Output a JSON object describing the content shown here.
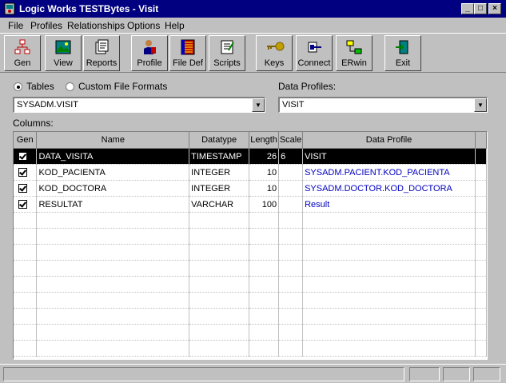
{
  "window": {
    "title": "Logic Works TESTBytes - Visit"
  },
  "menu": [
    {
      "label": "File"
    },
    {
      "label": "Profiles"
    },
    {
      "label": "Relationships"
    },
    {
      "label": "Options"
    },
    {
      "label": "Help"
    }
  ],
  "toolbar": {
    "gen": "Gen",
    "view": "View",
    "reports": "Reports",
    "profile": "Profile",
    "filedef": "File Def",
    "scripts": "Scripts",
    "keys": "Keys",
    "connect": "Connect",
    "erwin": "ERwin",
    "exit": "Exit"
  },
  "form": {
    "tables_label": "Tables",
    "custom_label": "Custom File Formats",
    "selected_mode": "tables",
    "table_value": "SYSADM.VISIT",
    "data_profiles_label": "Data Profiles:",
    "data_profile_value": "VISIT",
    "columns_label": "Columns:"
  },
  "grid": {
    "headers": [
      "Gen",
      "Name",
      "Datatype",
      "Length",
      "Scale",
      "Data Profile"
    ],
    "rows": [
      {
        "gen": true,
        "name": "DATA_VISITA",
        "datatype": "TIMESTAMP",
        "length": "26",
        "scale": "6",
        "profile": "VISIT",
        "selected": true
      },
      {
        "gen": true,
        "name": "KOD_PACIENTA",
        "datatype": "INTEGER",
        "length": "10",
        "scale": "",
        "profile": "SYSADM.PACIENT.KOD_PACIENTA",
        "selected": false
      },
      {
        "gen": true,
        "name": "KOD_DOCTORA",
        "datatype": "INTEGER",
        "length": "10",
        "scale": "",
        "profile": "SYSADM.DOCTOR.KOD_DOCTORA",
        "selected": false
      },
      {
        "gen": true,
        "name": "RESULTAT",
        "datatype": "VARCHAR",
        "length": "100",
        "scale": "",
        "profile": "Result",
        "selected": false
      }
    ]
  },
  "colors": {
    "titlebar": "#000080",
    "face": "#c0c0c0",
    "profile_link": "#0000c0"
  }
}
